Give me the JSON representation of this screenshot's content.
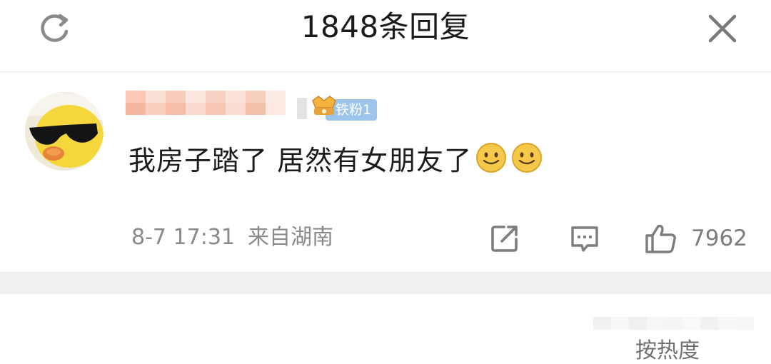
{
  "header": {
    "title": "1848条回复",
    "refresh_icon": "refresh-icon",
    "close_icon": "close-icon"
  },
  "comment": {
    "username": "",
    "fan_badge": "铁粉1",
    "text": "我房子踏了 居然有女朋友了",
    "emojis": [
      "smile-emoji",
      "smile-emoji"
    ],
    "time": "8-7 17:31",
    "location": "来自湖南",
    "like_count": "7962"
  },
  "footer": {
    "partial_text": "按热度"
  },
  "colors": {
    "badge_bg": "#9dc4ea",
    "meta_text": "#8a8a8a",
    "icon": "#7d7d7d",
    "emoji_face": "#f6c84a"
  }
}
